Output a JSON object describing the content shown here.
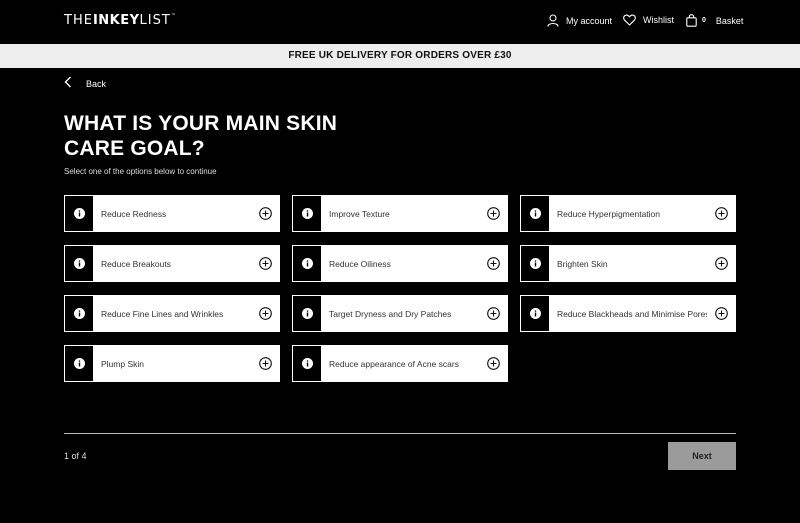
{
  "header": {
    "logo_pre": "THE",
    "logo_main": "INKEY",
    "logo_post": "LIST",
    "logo_mark": "™",
    "account_label": "My account",
    "wishlist_label": "Wishlist",
    "basket_count": "0",
    "basket_label": "Basket"
  },
  "banner": {
    "text": "FREE UK DELIVERY FOR ORDERS OVER £30"
  },
  "back": {
    "label": "Back"
  },
  "quiz": {
    "title": "WHAT IS YOUR MAIN SKIN CARE GOAL?",
    "subtitle": "Select one of the options below to continue",
    "options": [
      {
        "label": "Reduce Redness"
      },
      {
        "label": "Improve Texture"
      },
      {
        "label": "Reduce Hyperpigmentation"
      },
      {
        "label": "Reduce Breakouts"
      },
      {
        "label": "Reduce Oiliness"
      },
      {
        "label": "Brighten Skin"
      },
      {
        "label": "Reduce Fine Lines and Wrinkles"
      },
      {
        "label": "Target Dryness and Dry Patches"
      },
      {
        "label": "Reduce Blackheads and Minimise Pores"
      },
      {
        "label": "Plump Skin"
      },
      {
        "label": "Reduce appearance of Acne scars"
      }
    ]
  },
  "footer": {
    "pager": "1 of 4",
    "next_label": "Next"
  },
  "colors": {
    "background": "#000000",
    "banner": "#ededed",
    "next_disabled": "#9b9b9b"
  }
}
